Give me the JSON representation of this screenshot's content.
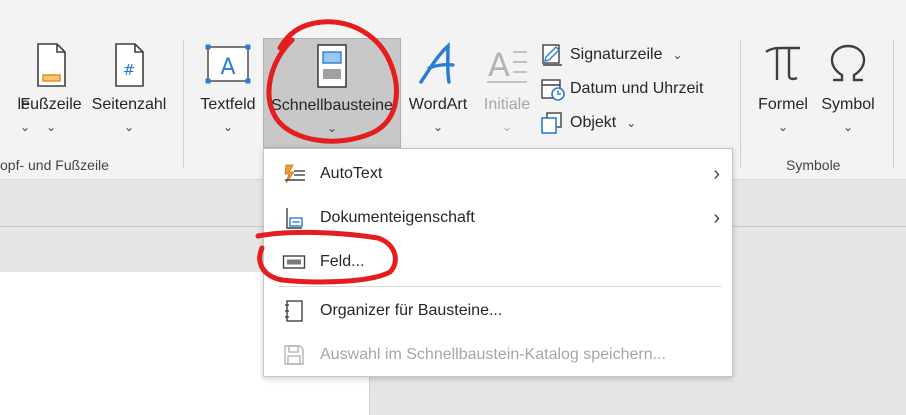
{
  "ribbon": {
    "groups": {
      "header_footer": "opf- und Fußzeile",
      "symbols": "Symbole"
    },
    "buttons": {
      "kopfzeile_partial": "le",
      "fusszeile": "Fußzeile",
      "seitenzahl": "Seitenzahl",
      "textfeld": "Textfeld",
      "schnellbausteine": "Schnellbausteine",
      "wordart": "WordArt",
      "initiale": "Initiale",
      "formel": "Formel",
      "symbol": "Symbol"
    },
    "small_buttons": {
      "signaturzeile": "Signaturzeile",
      "datum_uhrzeit": "Datum und Uhrzeit",
      "objekt": "Objekt"
    },
    "chevron": "⌄"
  },
  "menu": {
    "items": [
      {
        "label": "AutoText",
        "submenu": true,
        "enabled": true
      },
      {
        "label": "Dokumenteigenschaft",
        "submenu": true,
        "enabled": true
      },
      {
        "label": "Feld...",
        "submenu": false,
        "enabled": true
      },
      {
        "label": "Organizer für Bausteine...",
        "submenu": false,
        "enabled": true
      },
      {
        "label": "Auswahl im Schnellbaustein-Katalog speichern...",
        "submenu": false,
        "enabled": false
      }
    ],
    "arrow": "›"
  },
  "colors": {
    "accent": "#2b7cd3",
    "annotation": "#e41e1e",
    "orange": "#f0a030"
  }
}
